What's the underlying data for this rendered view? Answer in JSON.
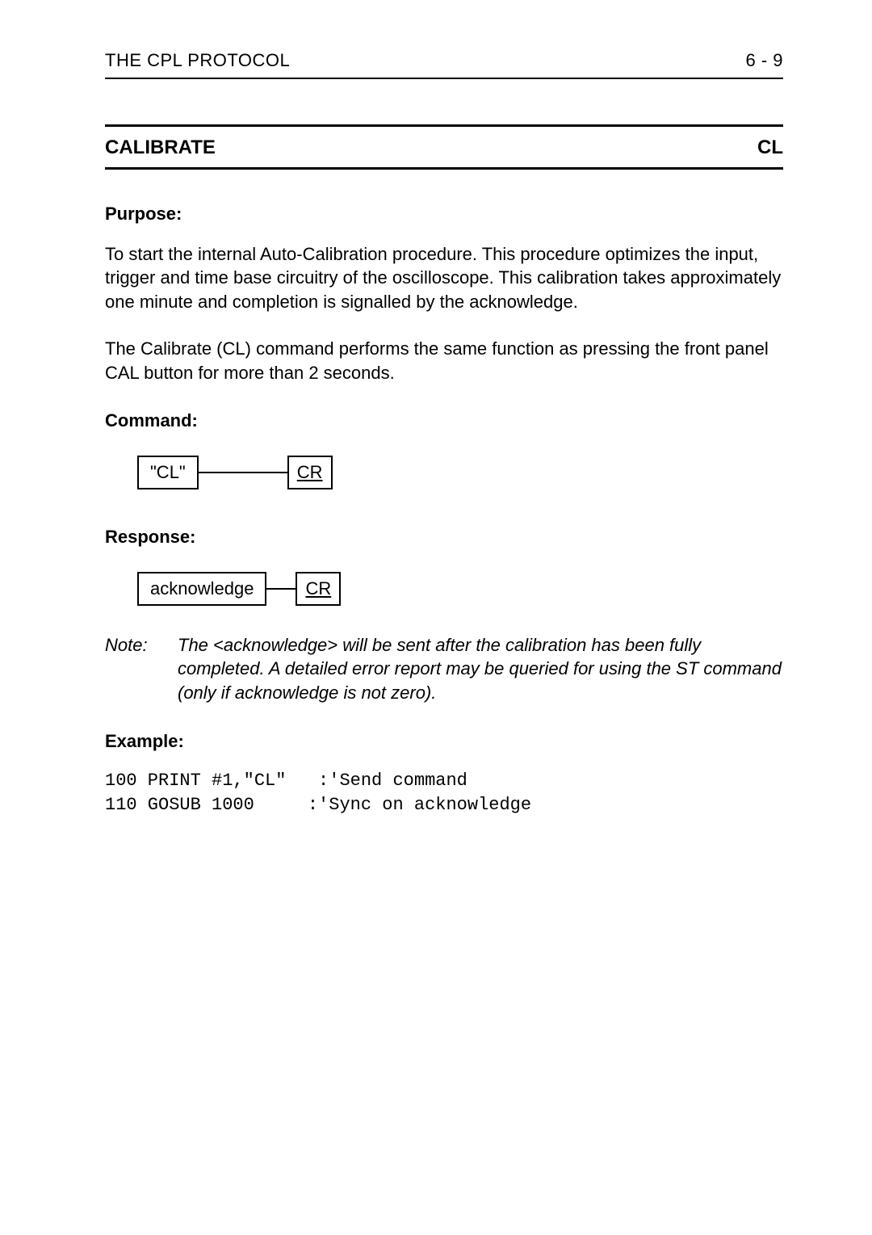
{
  "header": {
    "left": "THE CPL PROTOCOL",
    "right": "6 - 9"
  },
  "title": {
    "name": "CALIBRATE",
    "code": "CL"
  },
  "sections": {
    "purpose_head": "Purpose:",
    "purpose_p1": "To start the internal Auto-Calibration procedure. This procedure optimizes the input, trigger and time base circuitry of the oscilloscope. This calibration takes approximately one minute and completion is signalled by the acknowledge.",
    "purpose_p2": "The Calibrate (CL) command performs the same function as pressing the front panel CAL button for more than 2 seconds.",
    "command_head": "Command:",
    "command_token": "\"CL\"",
    "cr_label": "CR",
    "response_head": "Response:",
    "response_token": "acknowledge",
    "note_label": "Note:",
    "note_body": "The <acknowledge> will be sent after the calibration has been fully completed. A detailed error report may be queried for using the ST command (only if acknowledge is not zero).",
    "example_head": "Example:",
    "example_code": "100 PRINT #1,\"CL\"   :'Send command\n110 GOSUB 1000     :'Sync on acknowledge"
  }
}
